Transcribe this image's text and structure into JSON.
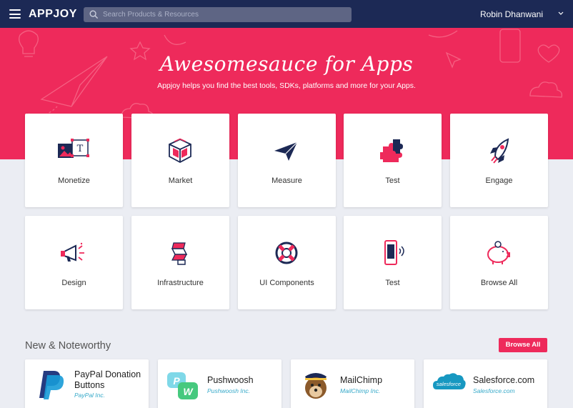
{
  "header": {
    "logo": "APPJOY",
    "search_placeholder": "Search Products & Resources",
    "user_name": "Robin Dhanwani",
    "menu_icon": "hamburger-icon",
    "search_icon": "search-icon",
    "user_dropdown_icon": "chevron-down-icon"
  },
  "hero": {
    "title": "Awesomesauce for Apps",
    "subtitle": "Appjoy helps you find the best tools, SDKs, platforms and more for your Apps."
  },
  "categories": [
    {
      "label": "Monetize",
      "icon": "image-text-icon"
    },
    {
      "label": "Market",
      "icon": "cube-icon"
    },
    {
      "label": "Measure",
      "icon": "paper-plane-icon"
    },
    {
      "label": "Test",
      "icon": "puzzle-icon"
    },
    {
      "label": "Engage",
      "icon": "rocket-icon"
    },
    {
      "label": "Design",
      "icon": "megaphone-icon"
    },
    {
      "label": "Infrastructure",
      "icon": "server-stack-icon"
    },
    {
      "label": "UI Components",
      "icon": "lifebuoy-icon"
    },
    {
      "label": "Test",
      "icon": "mobile-phone-icon"
    },
    {
      "label": "Browse All",
      "icon": "piggy-bank-icon"
    }
  ],
  "noteworthy": {
    "title": "New & Noteworthy",
    "browse_all": "Browse All",
    "apps": [
      {
        "name": "PayPal Donation Buttons",
        "publisher": "PayPal Inc.",
        "logo": "paypal-logo"
      },
      {
        "name": "Pushwoosh",
        "publisher": "Pushwoosh Inc.",
        "logo": "pushwoosh-logo"
      },
      {
        "name": "MailChimp",
        "publisher": "MailChimp Inc.",
        "logo": "mailchimp-logo"
      },
      {
        "name": "Salesforce.com",
        "publisher": "Salesforce.com",
        "logo": "salesforce-logo",
        "logo_text": "salesforce"
      }
    ]
  },
  "colors": {
    "navbar": "#1c2955",
    "accent": "#ee2a5b",
    "icon_navy": "#1c2955",
    "link": "#36a9c9"
  }
}
